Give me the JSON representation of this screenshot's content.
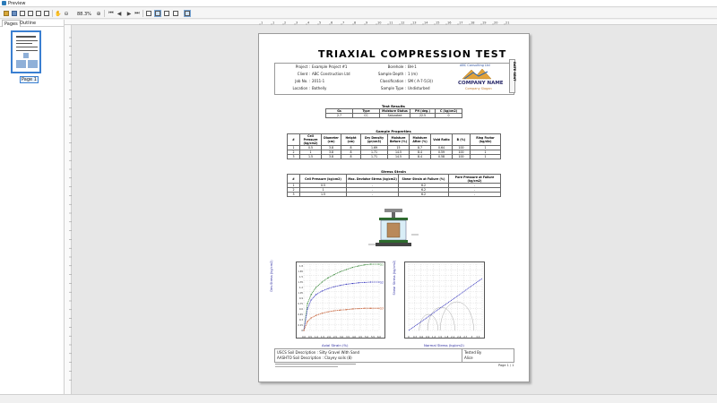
{
  "window": {
    "title": "Preview"
  },
  "toolbar": {
    "zoom": "88.3%"
  },
  "left_panel": {
    "tabs": [
      "Pages",
      "Outline"
    ],
    "thumbnail_label": "Page 1"
  },
  "ruler_numbers": [
    "1",
    "1",
    "2",
    "3",
    "4",
    "5",
    "6",
    "7",
    "8",
    "9",
    "10",
    "11",
    "12",
    "13",
    "14",
    "15",
    "16",
    "17",
    "18",
    "19",
    "20",
    "21"
  ],
  "report": {
    "title": "TRIAXIAL COMPRESSION TEST",
    "company": {
      "consulting": "ABC Consulting Ltd",
      "name": "COMPANY NAME",
      "slogan": "Company Slogan"
    },
    "side_label": "DATE SENT",
    "meta_left": [
      {
        "label": "Project :",
        "value": "Example Project #1"
      },
      {
        "label": "Client :",
        "value": "ABC Construction Ltd"
      },
      {
        "label": "Job No. :",
        "value": "2011-1"
      },
      {
        "label": "Location :",
        "value": "Bothelly"
      }
    ],
    "meta_right": [
      {
        "label": "Borehole :",
        "value": "BH-1"
      },
      {
        "label": "Sample Depth :",
        "value": "1 (m)"
      },
      {
        "label": "Classification :",
        "value": "SM ( A-7-5(3))"
      },
      {
        "label": "Sample Type :",
        "value": "Undisturbed"
      }
    ],
    "test_results": {
      "caption": "Test Results",
      "headers": [
        "Gs",
        "Type",
        "Moisture Status",
        "PH (deg.)",
        "C (kg/cm2)"
      ],
      "rows": [
        [
          "2.7",
          "CC",
          "Saturated",
          "22.5",
          "0"
        ]
      ]
    },
    "sample_properties": {
      "caption": "Sample Properties",
      "headers": [
        "#",
        "Cell Pressure (kg/cm2)",
        "Diameter (cm)",
        "Height (cm)",
        "Dry Density (gr/cm3)",
        "Moisture Before (%)",
        "Moisture After (%)",
        "Void Ratio",
        "B (%)",
        "Ring Factor (kg/div)"
      ],
      "rows": [
        [
          "1",
          "0.5",
          "3.8",
          "8",
          "1.69",
          "15",
          "8.7",
          "0.64",
          "100",
          "1"
        ],
        [
          "2",
          "1",
          "3.8",
          "8",
          "1.71",
          "14.5",
          "8.4",
          "0.59",
          "100",
          "1"
        ],
        [
          "3",
          "1.5",
          "3.8",
          "8",
          "1.71",
          "14.5",
          "8.4",
          "0.58",
          "100",
          "1"
        ]
      ]
    },
    "stress_strain": {
      "caption": "Stress Strain",
      "headers": [
        "#",
        "Cell Pressure (kg/cm2)",
        "Max. Deviator Stress (kg/cm2)",
        "Shear Strain at Failure (%)",
        "Pore Pressure at Failure (kg/cm2)"
      ],
      "rows": [
        [
          "1",
          "0.5",
          "-",
          "6.2",
          "-"
        ],
        [
          "2",
          "1",
          "-",
          "6.2",
          "-"
        ],
        [
          "3",
          "1.5",
          "-",
          "6.2",
          "-"
        ]
      ]
    },
    "footer": {
      "desc1": "USCS Soil Description : Silty Gravel With Sand",
      "desc2": "AASHTO Soil Description : Clayey soils (8)",
      "tested_by_label": "Tested By",
      "tested_by_value": "Alice",
      "page": "Page 1 / 1"
    }
  },
  "chart_data": [
    {
      "type": "line",
      "xlabel": "Axial Strain (%)",
      "ylabel": "Dev.Stress (kg/cm2)",
      "ylim": [
        0,
        1.85
      ],
      "xlim": [
        0,
        6.2
      ],
      "y_ticks": [
        "0",
        "0.15",
        "0.3",
        "0.45",
        "0.6",
        "0.75",
        "0.9",
        "1.05",
        "1.2",
        "1.35",
        "1.5",
        "1.65",
        "1.8",
        "1.95"
      ],
      "grid": true,
      "series": [
        {
          "name": "S1",
          "color": "#3c8a3c",
          "x": [
            0,
            0.3,
            0.6,
            1,
            1.5,
            2,
            2.5,
            3,
            3.5,
            4,
            4.5,
            5,
            5.5,
            6.2
          ],
          "y": [
            0,
            0.75,
            1.0,
            1.2,
            1.35,
            1.47,
            1.56,
            1.64,
            1.7,
            1.76,
            1.8,
            1.83,
            1.85,
            1.85
          ]
        },
        {
          "name": "S2",
          "color": "#3b3bbf",
          "x": [
            0,
            0.3,
            0.6,
            1,
            1.5,
            2,
            2.5,
            3,
            3.5,
            4,
            4.5,
            5,
            5.5,
            6.2
          ],
          "y": [
            0,
            0.6,
            0.85,
            1.0,
            1.1,
            1.17,
            1.22,
            1.26,
            1.29,
            1.31,
            1.33,
            1.34,
            1.35,
            1.35
          ]
        },
        {
          "name": "S3",
          "color": "#c2572b",
          "x": [
            0,
            0.3,
            0.6,
            1,
            1.5,
            2,
            2.5,
            3,
            3.5,
            4,
            4.5,
            5,
            5.5,
            6.2
          ],
          "y": [
            0,
            0.25,
            0.35,
            0.42,
            0.48,
            0.52,
            0.55,
            0.57,
            0.58,
            0.6,
            0.61,
            0.62,
            0.62,
            0.62
          ]
        }
      ]
    },
    {
      "type": "scatter",
      "xlabel": "Normal Stress (kg/cm2)",
      "ylabel": "Shear Stress (kg/cm2)",
      "xlim": [
        0,
        3.5
      ],
      "ylim": [
        0,
        1.85
      ],
      "x_ticks": [
        "0",
        "0.3",
        "0.6",
        "0.9",
        "1.2",
        "1.5",
        "1.8",
        "2.1",
        "2.4",
        "2.7",
        "3",
        "3.3"
      ],
      "grid": true,
      "envelope": {
        "x": [
          0,
          3.5
        ],
        "y": [
          0,
          1.45
        ]
      },
      "circles": [
        {
          "center": 0.95,
          "radius": 0.45
        },
        {
          "center": 1.55,
          "radius": 0.65
        },
        {
          "center": 2.3,
          "radius": 0.8
        }
      ]
    }
  ]
}
